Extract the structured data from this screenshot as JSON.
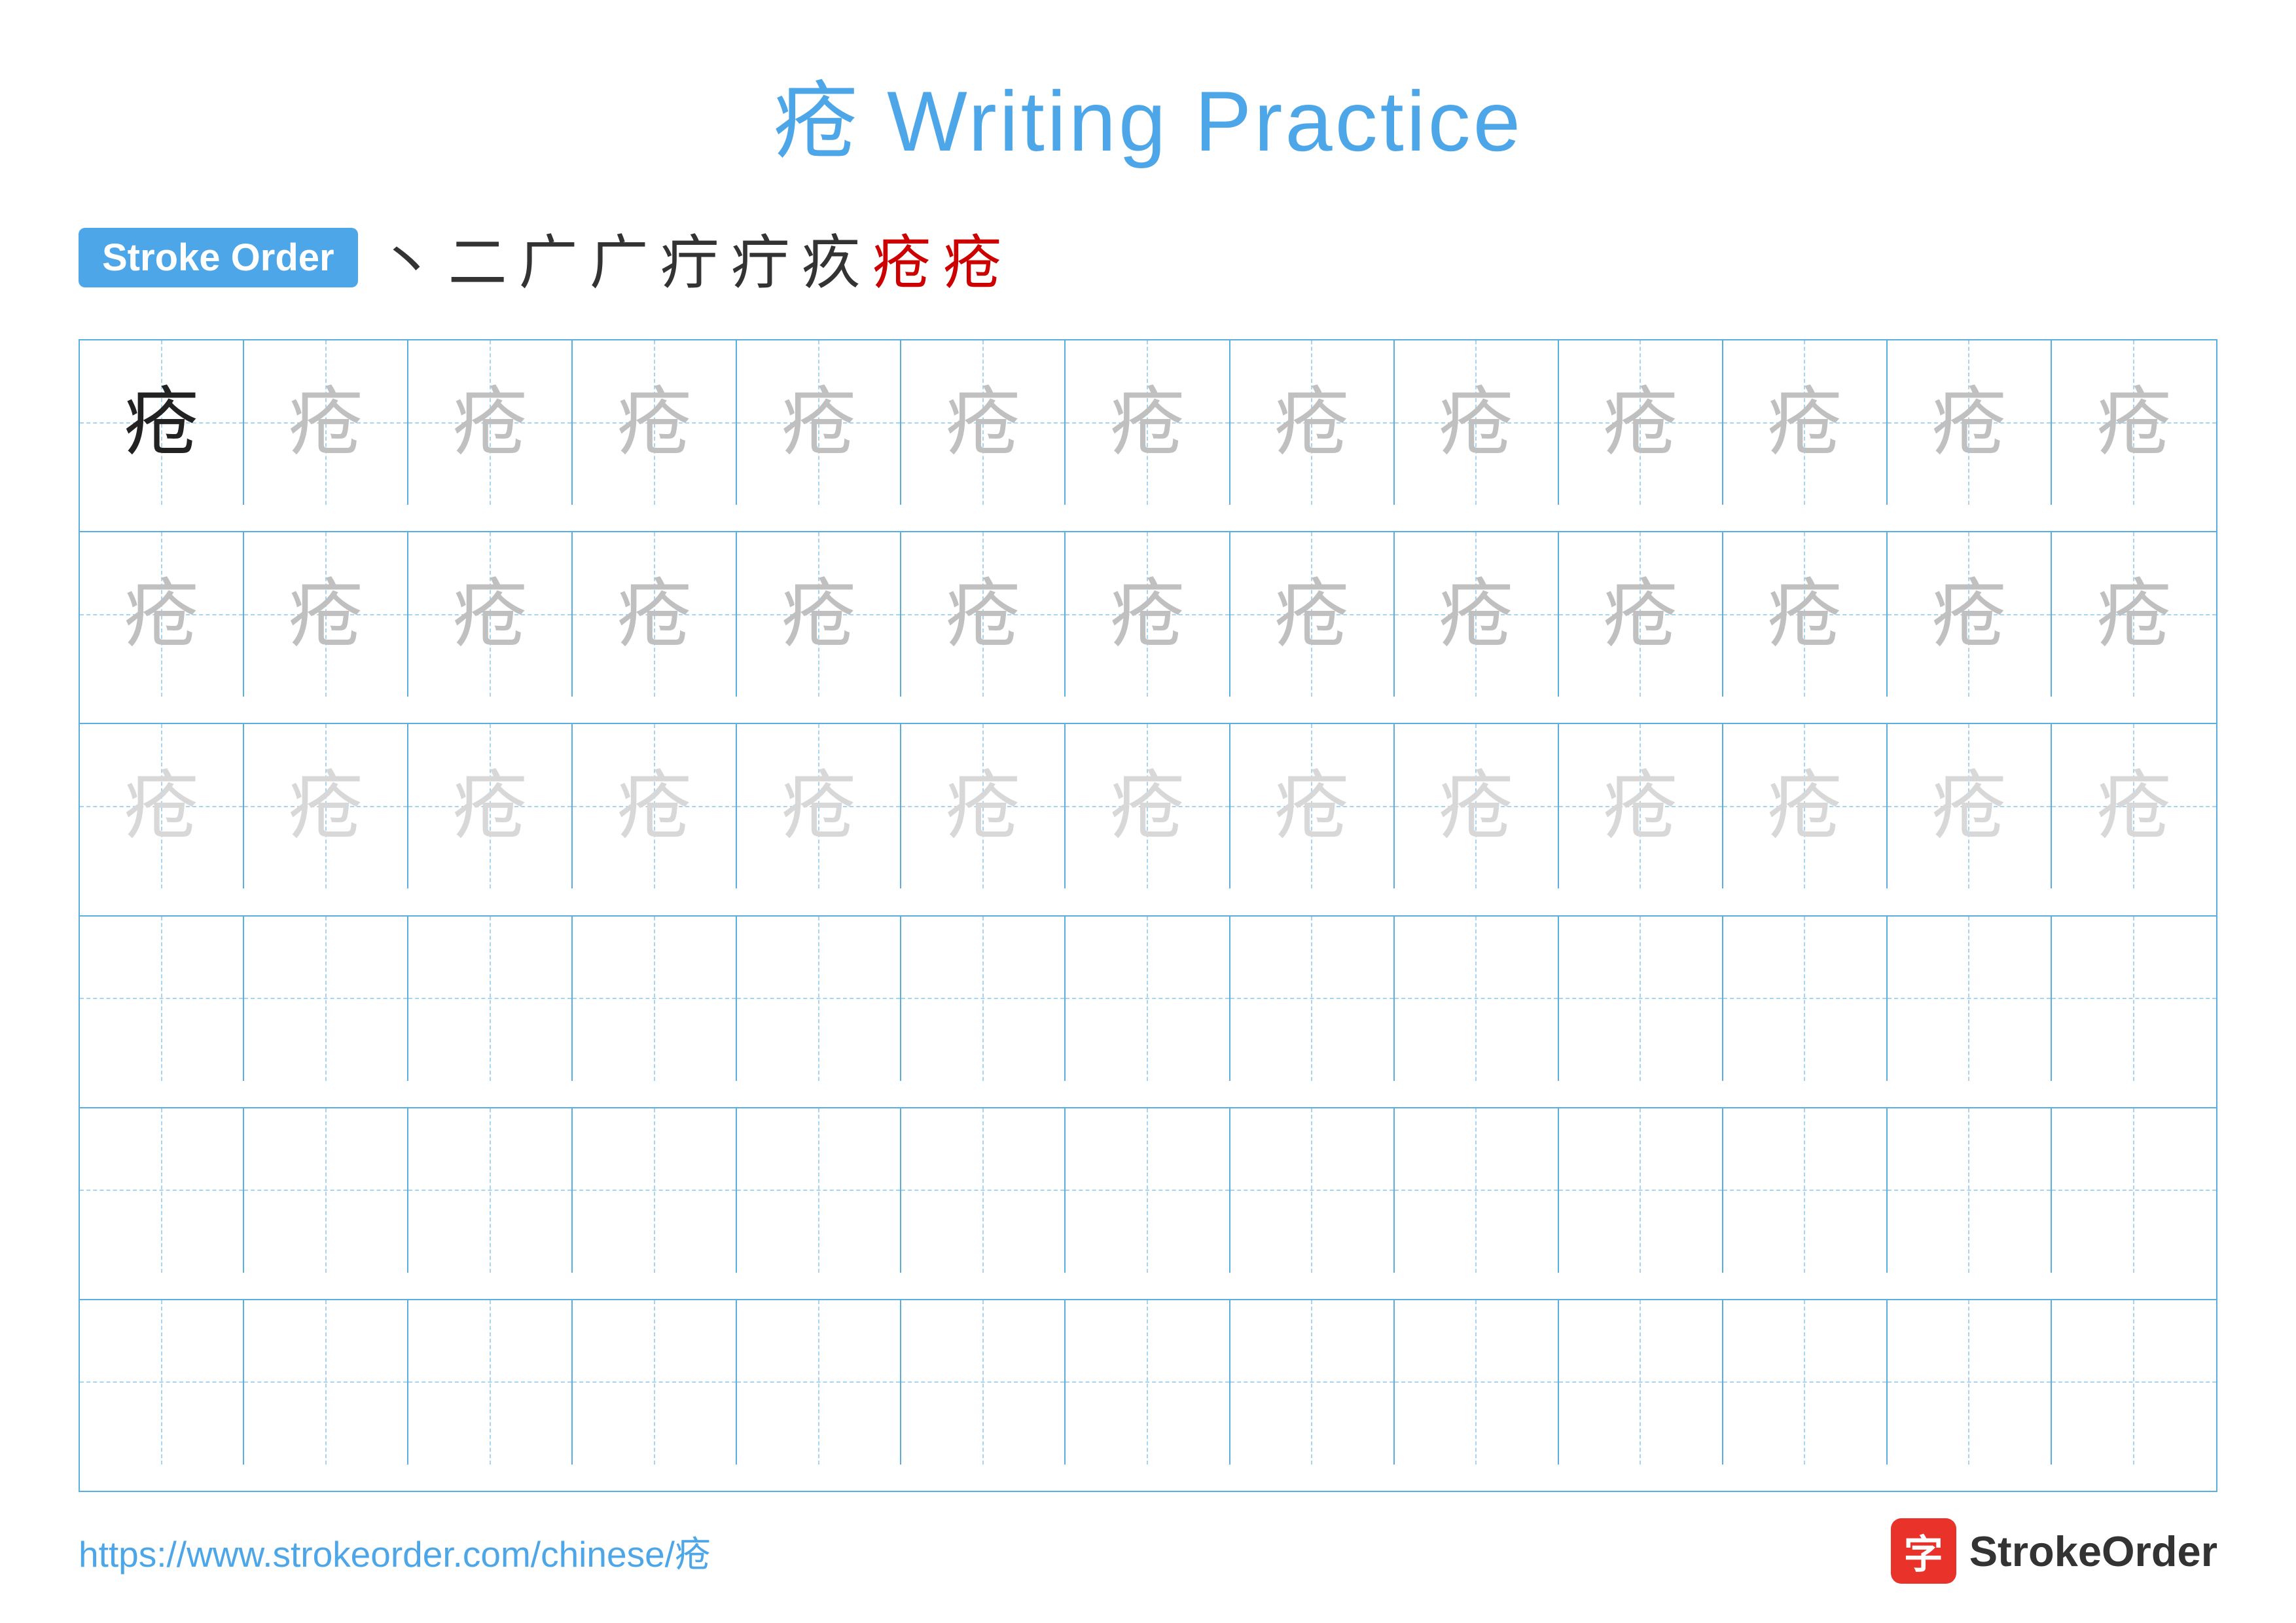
{
  "title": "疮 Writing Practice",
  "stroke_order": {
    "label": "Stroke Order",
    "sequence": [
      "丶",
      "二",
      "广",
      "广",
      "疔",
      "疔",
      "疚",
      "疮",
      "疮"
    ]
  },
  "grid": {
    "rows": 6,
    "cols": 13,
    "char": "疮",
    "char_display": [
      [
        "dark",
        "medium-gray",
        "medium-gray",
        "medium-gray",
        "medium-gray",
        "medium-gray",
        "medium-gray",
        "medium-gray",
        "medium-gray",
        "medium-gray",
        "medium-gray",
        "medium-gray",
        "medium-gray"
      ],
      [
        "medium-gray",
        "medium-gray",
        "medium-gray",
        "medium-gray",
        "medium-gray",
        "medium-gray",
        "medium-gray",
        "medium-gray",
        "medium-gray",
        "medium-gray",
        "medium-gray",
        "medium-gray",
        "medium-gray"
      ],
      [
        "light-gray",
        "light-gray",
        "light-gray",
        "light-gray",
        "light-gray",
        "light-gray",
        "light-gray",
        "light-gray",
        "light-gray",
        "light-gray",
        "light-gray",
        "light-gray",
        "light-gray"
      ],
      [
        "empty",
        "empty",
        "empty",
        "empty",
        "empty",
        "empty",
        "empty",
        "empty",
        "empty",
        "empty",
        "empty",
        "empty",
        "empty"
      ],
      [
        "empty",
        "empty",
        "empty",
        "empty",
        "empty",
        "empty",
        "empty",
        "empty",
        "empty",
        "empty",
        "empty",
        "empty",
        "empty"
      ],
      [
        "empty",
        "empty",
        "empty",
        "empty",
        "empty",
        "empty",
        "empty",
        "empty",
        "empty",
        "empty",
        "empty",
        "empty",
        "empty"
      ]
    ]
  },
  "footer": {
    "url": "https://www.strokeorder.com/chinese/疮",
    "logo_char": "字",
    "logo_name": "StrokeOrder"
  }
}
